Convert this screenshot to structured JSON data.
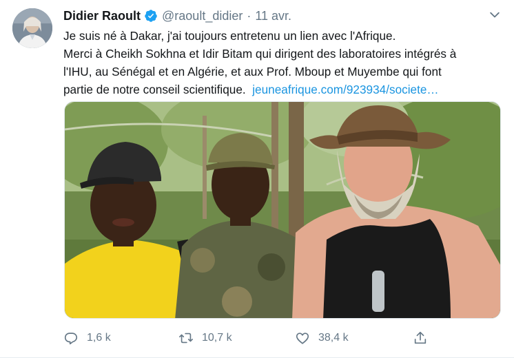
{
  "tweet": {
    "author_name": "Didier Raoult",
    "author_handle": "@raoult_didier",
    "separator": "·",
    "date": "11 avr.",
    "text_lines": [
      "Je suis né à Dakar, j'ai toujours entretenu un lien avec l'Afrique.",
      "Merci à Cheikh Sokhna et Idir Bitam qui dirigent des laboratoires intégrés à",
      "l'IHU, au Sénégal et en Algérie, et aux Prof. Mboup et Muyembe qui font",
      "partie de notre conseil scientifique."
    ],
    "link_text": "jeuneafrique.com/923934/societe…",
    "media_description_hidden": ""
  },
  "actions": {
    "replies": "1,6 k",
    "retweets": "10,7 k",
    "likes": "38,4 k"
  },
  "colors": {
    "link": "#1b95e0",
    "secondary_text": "#657786",
    "verified_badge": "#1da1f2"
  },
  "icons": [
    "verified-badge-icon",
    "chevron-down-icon",
    "reply-icon",
    "retweet-icon",
    "like-icon",
    "share-icon"
  ]
}
